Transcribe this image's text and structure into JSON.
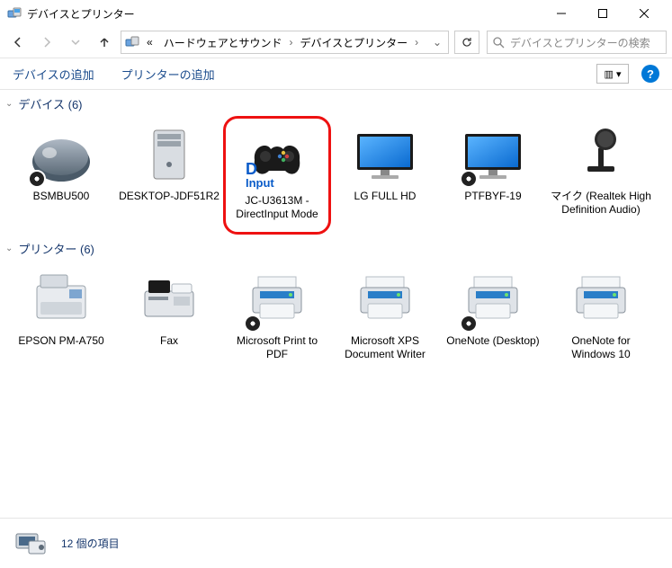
{
  "window": {
    "title": "デバイスとプリンター"
  },
  "nav": {
    "crumb_prefix": "«",
    "crumb1": "ハードウェアとサウンド",
    "crumb2": "デバイスとプリンター"
  },
  "search": {
    "placeholder": "デバイスとプリンターの検索"
  },
  "toolbar": {
    "add_device": "デバイスの追加",
    "add_printer": "プリンターの追加",
    "view_glyph": "▥ ▾"
  },
  "groups": [
    {
      "header": "デバイス (6)",
      "items": [
        {
          "label": "BSMBU500",
          "icon": "mouse",
          "badge": "clock"
        },
        {
          "label": "DESKTOP-JDF51R2",
          "icon": "pc"
        },
        {
          "label": "JC-U3613M - DirectInput Mode",
          "icon": "gamepad",
          "highlighted": true,
          "overlay": "D\nInput"
        },
        {
          "label": "LG FULL HD",
          "icon": "monitor"
        },
        {
          "label": "PTFBYF-19",
          "icon": "monitor",
          "badge": "clock"
        },
        {
          "label": "マイク (Realtek High Definition Audio)",
          "icon": "mic"
        }
      ]
    },
    {
      "header": "プリンター (6)",
      "items": [
        {
          "label": "EPSON PM-A750",
          "icon": "mfp"
        },
        {
          "label": "Fax",
          "icon": "fax"
        },
        {
          "label": "Microsoft Print to PDF",
          "icon": "printer",
          "badge": "clock"
        },
        {
          "label": "Microsoft XPS Document Writer",
          "icon": "printer"
        },
        {
          "label": "OneNote (Desktop)",
          "icon": "printer",
          "badge": "clock"
        },
        {
          "label": "OneNote for Windows 10",
          "icon": "printer"
        }
      ]
    }
  ],
  "status": {
    "text": "12 個の項目"
  }
}
